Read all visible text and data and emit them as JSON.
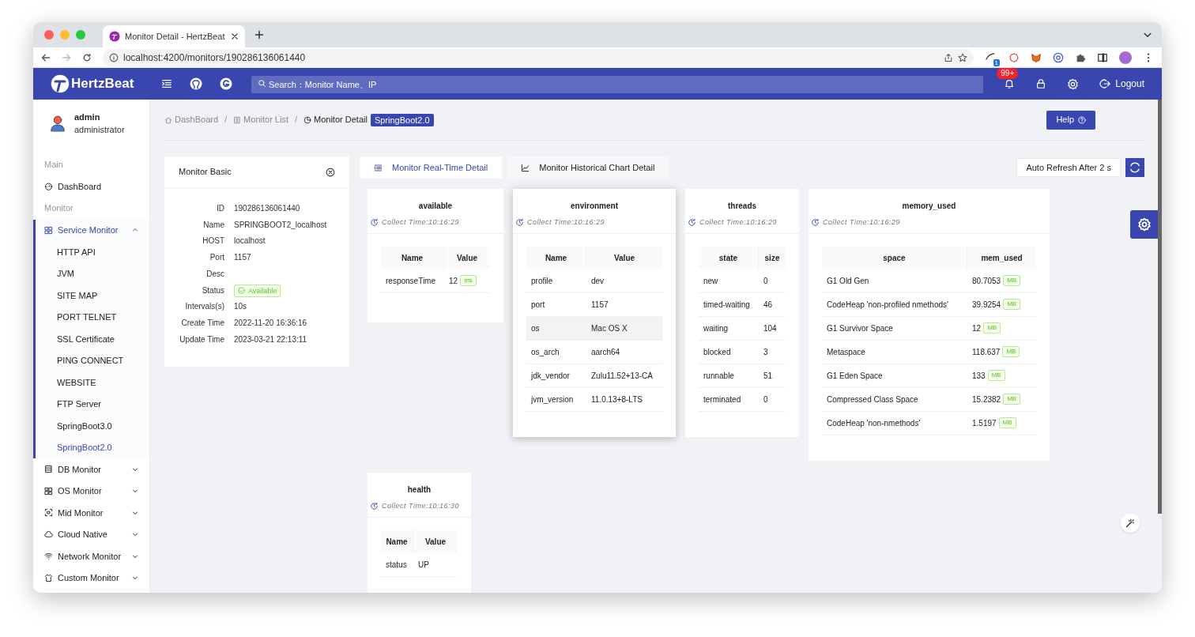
{
  "browser": {
    "tab_title": "Monitor Detail - HertzBeat",
    "url": "localhost:4200/monitors/190286136061440",
    "extension_badge": "1"
  },
  "header": {
    "logo_text": "HertzBeat",
    "search_placeholder": "Search：Monitor Name、IP",
    "notification_count": "99+",
    "logout": "Logout"
  },
  "user": {
    "name": "admin",
    "role": "administrator"
  },
  "sidebar": [
    {
      "title": "Main",
      "items": [
        {
          "label": "DashBoard",
          "selected": false,
          "expanded": false
        }
      ]
    },
    {
      "title": "Monitor",
      "items": [
        {
          "label": "Service Monitor",
          "selected": true,
          "expanded": true,
          "children": [
            {
              "label": "HTTP API",
              "selected": false
            },
            {
              "label": "JVM",
              "selected": false
            },
            {
              "label": "SITE MAP",
              "selected": false
            },
            {
              "label": "PORT TELNET",
              "selected": false
            },
            {
              "label": "SSL Certificate",
              "selected": false
            },
            {
              "label": "PING CONNECT",
              "selected": false
            },
            {
              "label": "WEBSITE",
              "selected": false
            },
            {
              "label": "FTP Server",
              "selected": false
            },
            {
              "label": "SpringBoot3.0",
              "selected": false
            },
            {
              "label": "SpringBoot2.0",
              "selected": true
            }
          ]
        },
        {
          "label": "DB Monitor",
          "selected": false,
          "expanded": false
        },
        {
          "label": "OS Monitor",
          "selected": false,
          "expanded": false
        },
        {
          "label": "Mid Monitor",
          "selected": false,
          "expanded": false
        },
        {
          "label": "Cloud Native",
          "selected": false,
          "expanded": false
        },
        {
          "label": "Network Monitor",
          "selected": false,
          "expanded": false
        },
        {
          "label": "Custom Monitor",
          "selected": false,
          "expanded": false
        }
      ]
    }
  ],
  "breadcrumb": [
    {
      "label": "DashBoard",
      "current": false
    },
    {
      "separator": "/",
      "label": "Monitor List",
      "current": false
    },
    {
      "separator": "/",
      "label": "Monitor Detail",
      "current": true
    }
  ],
  "breadcrumb_tag": "SpringBoot2.0",
  "help_button": "Help",
  "basic": {
    "title": "Monitor Basic",
    "fields": [
      {
        "label": "ID",
        "value": "190286136061440",
        "kind": "text"
      },
      {
        "label": "Name",
        "value": "SPRINGBOOT2_localhost",
        "kind": "text"
      },
      {
        "label": "HOST",
        "value": "localhost",
        "kind": "text"
      },
      {
        "label": "Port",
        "value": "1157",
        "kind": "text"
      },
      {
        "label": "Desc",
        "kind": "text"
      },
      {
        "label": "Status",
        "value": "Available",
        "kind": "status"
      },
      {
        "label": "Intervals(s)",
        "value": "10s",
        "kind": "text"
      },
      {
        "label": "Create Time",
        "value": "2022-11-20 16:36:16",
        "kind": "text"
      },
      {
        "label": "Update Time",
        "value": "2023-03-21 22:13:11",
        "kind": "text"
      }
    ]
  },
  "tabs": [
    {
      "label": "Monitor Real-Time Detail",
      "selected": true
    },
    {
      "label": "Monitor Historical Chart Detail",
      "selected": false
    }
  ],
  "auto_refresh": "Auto Refresh After 2 s",
  "metric_cards": [
    {
      "title": "available",
      "collect_time": "Collect Time:10:16:29",
      "hovered": false,
      "columns": [
        "Name",
        "Value"
      ],
      "rows": [
        {
          "hovered": false,
          "cells": [
            {
              "text": "responseTime"
            },
            {
              "text": "12",
              "unit": "ms"
            }
          ]
        }
      ]
    },
    {
      "title": "environment",
      "collect_time": "Collect Time:10:16:29",
      "hovered": true,
      "columns": [
        "Name",
        "Value"
      ],
      "rows": [
        {
          "hovered": false,
          "cells": [
            {
              "text": "profile"
            },
            {
              "text": "dev"
            }
          ]
        },
        {
          "hovered": false,
          "cells": [
            {
              "text": "port"
            },
            {
              "text": "1157"
            }
          ]
        },
        {
          "hovered": true,
          "cells": [
            {
              "text": "os"
            },
            {
              "text": "Mac OS X"
            }
          ]
        },
        {
          "hovered": false,
          "cells": [
            {
              "text": "os_arch"
            },
            {
              "text": "aarch64"
            }
          ]
        },
        {
          "hovered": false,
          "cells": [
            {
              "text": "jdk_vendor"
            },
            {
              "text": "Zulu11.52+13-CA"
            }
          ]
        },
        {
          "hovered": false,
          "cells": [
            {
              "text": "jvm_version"
            },
            {
              "text": "11.0.13+8-LTS"
            }
          ]
        }
      ]
    },
    {
      "title": "threads",
      "collect_time": "Collect Time:10:16:29",
      "hovered": false,
      "columns": [
        "state",
        "size"
      ],
      "rows": [
        {
          "hovered": false,
          "cells": [
            {
              "text": "new"
            },
            {
              "text": "0"
            }
          ]
        },
        {
          "hovered": false,
          "cells": [
            {
              "text": "timed-waiting"
            },
            {
              "text": "46"
            }
          ]
        },
        {
          "hovered": false,
          "cells": [
            {
              "text": "waiting"
            },
            {
              "text": "104"
            }
          ]
        },
        {
          "hovered": false,
          "cells": [
            {
              "text": "blocked"
            },
            {
              "text": "3"
            }
          ]
        },
        {
          "hovered": false,
          "cells": [
            {
              "text": "runnable"
            },
            {
              "text": "51"
            }
          ]
        },
        {
          "hovered": false,
          "cells": [
            {
              "text": "terminated"
            },
            {
              "text": "0"
            }
          ]
        }
      ]
    },
    {
      "title": "memory_used",
      "collect_time": "Collect Time:10:16:29",
      "hovered": false,
      "columns": [
        "space",
        "mem_used"
      ],
      "rows": [
        {
          "hovered": false,
          "cells": [
            {
              "text": "G1 Old Gen"
            },
            {
              "text": "80.7053",
              "unit": "MB"
            }
          ]
        },
        {
          "hovered": false,
          "cells": [
            {
              "text": "CodeHeap 'non-profiled nmethods'"
            },
            {
              "text": "39.9254",
              "unit": "MB"
            }
          ]
        },
        {
          "hovered": false,
          "cells": [
            {
              "text": "G1 Survivor Space"
            },
            {
              "text": "12",
              "unit": "MB"
            }
          ]
        },
        {
          "hovered": false,
          "cells": [
            {
              "text": "Metaspace"
            },
            {
              "text": "118.637",
              "unit": "MB"
            }
          ]
        },
        {
          "hovered": false,
          "cells": [
            {
              "text": "G1 Eden Space"
            },
            {
              "text": "133",
              "unit": "MB"
            }
          ]
        },
        {
          "hovered": false,
          "cells": [
            {
              "text": "Compressed Class Space"
            },
            {
              "text": "15.2382",
              "unit": "MB"
            }
          ]
        },
        {
          "hovered": false,
          "cells": [
            {
              "text": "CodeHeap 'non-nmethods'"
            },
            {
              "text": "1.5197",
              "unit": "MB"
            }
          ]
        }
      ]
    },
    {
      "title": "health",
      "collect_time": "Collect Time:10:16:30",
      "hovered": false,
      "columns": [
        "Name",
        "Value"
      ],
      "rows": [
        {
          "hovered": false,
          "cells": [
            {
              "text": "status"
            },
            {
              "text": "UP"
            }
          ]
        }
      ]
    }
  ]
}
